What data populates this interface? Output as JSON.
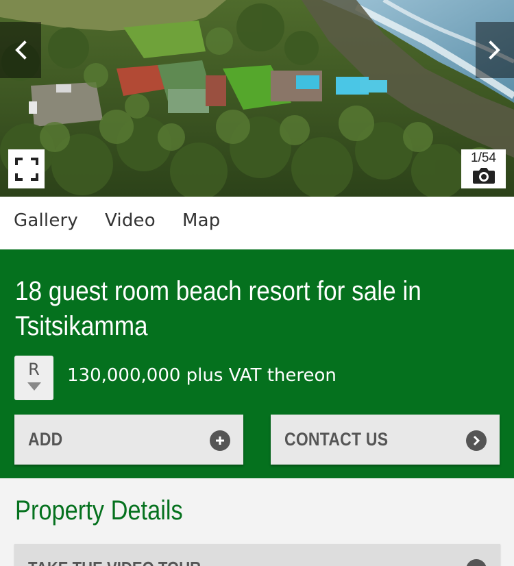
{
  "hero": {
    "photo_counter": "1/54",
    "icons": {
      "prev": "chevron-left-icon",
      "next": "chevron-right-icon",
      "fullscreen": "fullscreen-icon",
      "camera": "camera-icon"
    }
  },
  "tabs": {
    "gallery": "Gallery",
    "video": "Video",
    "map": "Map"
  },
  "listing": {
    "title": "18 guest room beach resort for sale in Tsitsikamma",
    "currency_symbol": "R",
    "price": "130,000,000 plus VAT thereon",
    "add_label": "ADD",
    "contact_label": "CONTACT US"
  },
  "details": {
    "heading": "Property Details",
    "video_tour_label": "TAKE THE VIDEO TOUR"
  },
  "colors": {
    "brand_green": "#05711e",
    "button_bg": "#e8e8e8",
    "button_text": "#555555"
  }
}
